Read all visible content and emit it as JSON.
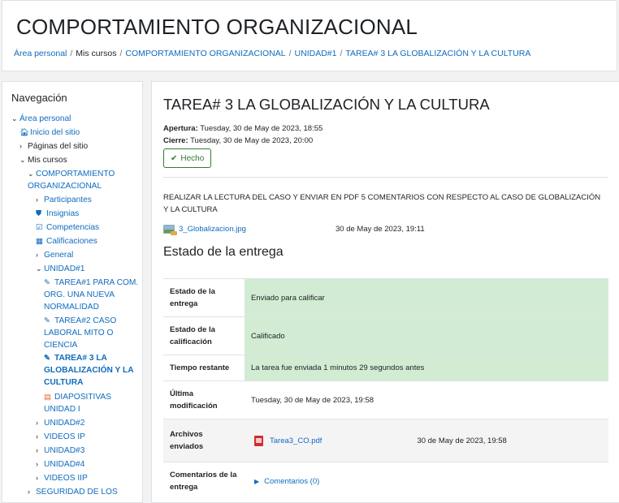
{
  "header": {
    "title": "COMPORTAMIENTO ORGANIZACIONAL",
    "breadcrumb": [
      "Área personal",
      "Mis cursos",
      "COMPORTAMIENTO ORGANIZACIONAL",
      "UNIDAD#1",
      "TAREA# 3 LA GLOBALIZACIÓN Y LA CULTURA"
    ]
  },
  "nav": {
    "title": "Navegación",
    "items": [
      {
        "label": "Área personal"
      },
      {
        "label": "Inicio del sitio"
      },
      {
        "label": "Páginas del sitio"
      },
      {
        "label": "Mis cursos"
      },
      {
        "label_l1": "COMPORTAMIENTO",
        "label_l2": "ORGANIZACIONAL"
      },
      {
        "label": "Participantes"
      },
      {
        "label": "Insignias"
      },
      {
        "label": "Competencias"
      },
      {
        "label": "Calificaciones"
      },
      {
        "label": "General"
      },
      {
        "label": "UNIDAD#1"
      },
      {
        "label_l1": "TAREA#1 PARA COM.",
        "label_l2": "ORG. UNA NUEVA",
        "label_l3": "NORMALIDAD"
      },
      {
        "label_l1": "TAREA#2 CASO",
        "label_l2": "LABORAL MITO O",
        "label_l3": "CIENCIA"
      },
      {
        "label_l1": "TAREA# 3 LA",
        "label_l2": "GLOBALIZACIÓN Y LA",
        "label_l3": "CULTURA"
      },
      {
        "label_l1": "DIAPOSITIVAS",
        "label_l2": "UNIDAD I"
      },
      {
        "label": "UNIDAD#2"
      },
      {
        "label": "VIDEOS IP"
      },
      {
        "label": "UNIDAD#3"
      },
      {
        "label": "UNIDAD#4"
      },
      {
        "label": "VIDEOS IIP"
      },
      {
        "label": "SEGURIDAD DE LOS"
      }
    ]
  },
  "task": {
    "title": "TAREA# 3 LA GLOBALIZACIÓN Y LA CULTURA",
    "opening_label": "Apertura:",
    "opening_value": "Tuesday, 30 de May de 2023, 18:55",
    "closing_label": "Cierre:",
    "closing_value": "Tuesday, 30 de May de 2023, 20:00",
    "done_label": "Hecho",
    "description": "REALIZAR LA LECTURA DEL CASO Y ENVIAR EN PDF 5 COMENTARIOS CON RESPECTO AL CASO DE GLOBALIZACIÓN Y LA CULTURA",
    "attachment_name": "3_Globalizacion.jpg",
    "attachment_date": "30 de May de 2023, 19:11"
  },
  "submission": {
    "section_title": "Estado de la entrega",
    "rows": [
      {
        "label": "Estado de la entrega",
        "value": "Enviado para calificar"
      },
      {
        "label": "Estado de la calificación",
        "value": "Calificado"
      },
      {
        "label": "Tiempo restante",
        "value": "La tarea fue enviada 1 minutos 29 segundos antes"
      },
      {
        "label": "Última modificación",
        "value": "Tuesday, 30 de May de 2023, 19:58"
      },
      {
        "label": "Archivos enviados",
        "file": "Tarea3_CO.pdf",
        "file_date": "30 de May de 2023, 19:58"
      },
      {
        "label": "Comentarios de la entrega",
        "value": "Comentarios (0)"
      }
    ]
  },
  "colors": {
    "link": "#0f6cbf",
    "success_bg": "#d2ecd3",
    "done_border": "#357a32"
  }
}
